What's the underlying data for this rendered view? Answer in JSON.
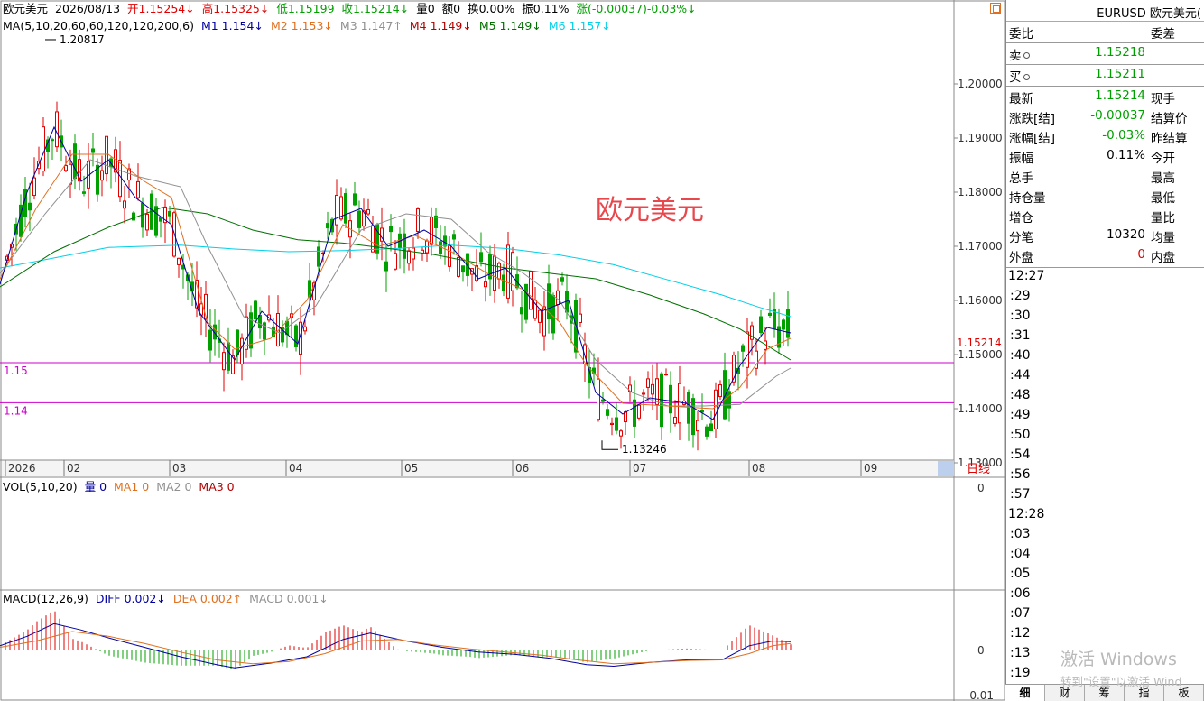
{
  "header": {
    "symbol_name": "欧元美元",
    "date": "2026/08/13",
    "open": "开1.15254↓",
    "high": "高1.15325↓",
    "low": "低1.15199",
    "close": "收1.15214↓",
    "volume": "量0",
    "amount": "额0",
    "turnover": "换0.00%",
    "amplitude": "振0.11%",
    "change": "涨(-0.00037)-0.03%↓"
  },
  "ma_legend": {
    "title": "MA(5,10,20,60,60,120,120,200,6)",
    "items": [
      {
        "label": "M1 1.154↓",
        "color": "#0000a0"
      },
      {
        "label": "M2 1.153↓",
        "color": "#e07020"
      },
      {
        "label": "M3 1.147↑",
        "color": "#909090"
      },
      {
        "label": "M4 1.149↓",
        "color": "#b00000"
      },
      {
        "label": "M5 1.149↓",
        "color": "#007000"
      },
      {
        "label": "M6 1.157↓",
        "color": "#00d0e8"
      }
    ]
  },
  "vol_legend": {
    "title": "VOL(5,10,20)",
    "items": [
      {
        "label": "量 0",
        "color": "#0000a0"
      },
      {
        "label": "MA1 0",
        "color": "#e07020"
      },
      {
        "label": "MA2 0",
        "color": "#909090"
      },
      {
        "label": "MA3 0",
        "color": "#b00000"
      }
    ]
  },
  "macd_legend": {
    "title": "MACD(12,26,9)",
    "items": [
      {
        "label": "DIFF 0.002↓",
        "color": "#0000a0"
      },
      {
        "label": "DEA 0.002↑",
        "color": "#e07020"
      },
      {
        "label": "MACD 0.001↓",
        "color": "#909090"
      }
    ]
  },
  "chart_label": "欧元美元",
  "chart_data": [
    {
      "type": "candlestick",
      "title": "欧元美元",
      "x_ticks": [
        "2026",
        "02",
        "03",
        "04",
        "05",
        "06",
        "07",
        "08",
        "09"
      ],
      "x_range_label": "日线",
      "y_ticks": [
        "1.20000",
        "1.19000",
        "1.18000",
        "1.17000",
        "1.16000",
        "1.15000",
        "1.14000",
        "1.13000"
      ],
      "ylim": [
        1.1286,
        1.2108
      ],
      "last_price_label": "1.15214",
      "annotations": [
        {
          "text": "1.20817",
          "value": 1.20817
        },
        {
          "text": "1.13246",
          "value": 1.13246
        }
      ],
      "horizontal_lines": [
        {
          "label": "1.15",
          "value": 1.1485,
          "color": "#cc00cc"
        },
        {
          "label": "1.14",
          "value": 1.1411,
          "color": "#cc00cc"
        }
      ],
      "ma_series": [
        {
          "name": "M6",
          "color": "#00d0e8",
          "values": [
            [
              0,
              1.166
            ],
            [
              40,
              1.1672
            ],
            [
              120,
              1.1698
            ],
            [
              200,
              1.1702
            ],
            [
              260,
              1.1695
            ],
            [
              320,
              1.169
            ],
            [
              380,
              1.1692
            ],
            [
              440,
              1.1696
            ],
            [
              500,
              1.1702
            ],
            [
              560,
              1.1696
            ],
            [
              620,
              1.1684
            ],
            [
              680,
              1.1666
            ],
            [
              740,
              1.1638
            ],
            [
              800,
              1.161
            ],
            [
              840,
              1.1588
            ],
            [
              876,
              1.157
            ]
          ]
        },
        {
          "name": "M5",
          "color": "#007000",
          "values": [
            [
              0,
              1.1625
            ],
            [
              60,
              1.169
            ],
            [
              120,
              1.1735
            ],
            [
              180,
              1.1772
            ],
            [
              230,
              1.176
            ],
            [
              280,
              1.173
            ],
            [
              330,
              1.1712
            ],
            [
              380,
              1.1706
            ],
            [
              430,
              1.1696
            ],
            [
              480,
              1.1685
            ],
            [
              520,
              1.1672
            ],
            [
              560,
              1.166
            ],
            [
              600,
              1.1652
            ],
            [
              660,
              1.164
            ],
            [
              720,
              1.161
            ],
            [
              780,
              1.1575
            ],
            [
              820,
              1.1547
            ],
            [
              876,
              1.149
            ]
          ]
        },
        {
          "name": "M3",
          "color": "#909090",
          "values": [
            [
              0,
              1.165
            ],
            [
              50,
              1.176
            ],
            [
              100,
              1.186
            ],
            [
              150,
              1.183
            ],
            [
              200,
              1.181
            ],
            [
              230,
              1.17
            ],
            [
              270,
              1.157
            ],
            [
              310,
              1.154
            ],
            [
              350,
              1.159
            ],
            [
              400,
              1.173
            ],
            [
              450,
              1.176
            ],
            [
              500,
              1.175
            ],
            [
              540,
              1.169
            ],
            [
              580,
              1.165
            ],
            [
              620,
              1.16
            ],
            [
              660,
              1.149
            ],
            [
              700,
              1.143
            ],
            [
              740,
              1.1405
            ],
            [
              780,
              1.1405
            ],
            [
              820,
              1.1408
            ],
            [
              860,
              1.146
            ],
            [
              876,
              1.1475
            ]
          ]
        },
        {
          "name": "M2",
          "color": "#e07020",
          "values": [
            [
              0,
              1.164
            ],
            [
              40,
              1.177
            ],
            [
              80,
              1.187
            ],
            [
              120,
              1.187
            ],
            [
              160,
              1.182
            ],
            [
              190,
              1.179
            ],
            [
              230,
              1.156
            ],
            [
              260,
              1.151
            ],
            [
              300,
              1.153
            ],
            [
              340,
              1.16
            ],
            [
              380,
              1.174
            ],
            [
              420,
              1.17
            ],
            [
              460,
              1.172
            ],
            [
              500,
              1.169
            ],
            [
              540,
              1.165
            ],
            [
              580,
              1.162
            ],
            [
              620,
              1.156
            ],
            [
              650,
              1.148
            ],
            [
              690,
              1.141
            ],
            [
              740,
              1.1405
            ],
            [
              790,
              1.14
            ],
            [
              820,
              1.144
            ],
            [
              850,
              1.151
            ],
            [
              876,
              1.153
            ]
          ]
        },
        {
          "name": "M1",
          "color": "#0000a0",
          "values": [
            [
              0,
              1.163
            ],
            [
              30,
              1.18
            ],
            [
              60,
              1.192
            ],
            [
              90,
              1.182
            ],
            [
              120,
              1.186
            ],
            [
              150,
              1.179
            ],
            [
              190,
              1.174
            ],
            [
              220,
              1.158
            ],
            [
              260,
              1.149
            ],
            [
              290,
              1.158
            ],
            [
              330,
              1.152
            ],
            [
              370,
              1.175
            ],
            [
              400,
              1.177
            ],
            [
              430,
              1.17
            ],
            [
              470,
              1.173
            ],
            [
              500,
              1.17
            ],
            [
              530,
              1.164
            ],
            [
              560,
              1.166
            ],
            [
              600,
              1.158
            ],
            [
              630,
              1.16
            ],
            [
              660,
              1.143
            ],
            [
              690,
              1.139
            ],
            [
              720,
              1.142
            ],
            [
              760,
              1.141
            ],
            [
              790,
              1.138
            ],
            [
              820,
              1.148
            ],
            [
              850,
              1.155
            ],
            [
              876,
              1.154
            ]
          ]
        }
      ]
    },
    {
      "type": "bar",
      "title": "VOL(5,10,20)",
      "y_ticks": [
        "0"
      ],
      "values": []
    },
    {
      "type": "line",
      "title": "MACD(12,26,9)",
      "y_ticks": [
        "0",
        "-0.01"
      ],
      "series": [
        {
          "name": "DIFF",
          "color": "#0000a0",
          "values": [
            [
              0,
              0.0015
            ],
            [
              30,
              0.0045
            ],
            [
              60,
              0.0085
            ],
            [
              90,
              0.0065
            ],
            [
              120,
              0.004
            ],
            [
              160,
              0.001
            ],
            [
              200,
              -0.002
            ],
            [
              240,
              -0.0045
            ],
            [
              260,
              -0.0055
            ],
            [
              300,
              -0.004
            ],
            [
              340,
              -0.002
            ],
            [
              380,
              0.0035
            ],
            [
              410,
              0.0055
            ],
            [
              450,
              0.003
            ],
            [
              490,
              0.001
            ],
            [
              530,
              -0.0005
            ],
            [
              570,
              -0.0012
            ],
            [
              610,
              -0.0025
            ],
            [
              650,
              -0.0045
            ],
            [
              680,
              -0.005
            ],
            [
              720,
              -0.0038
            ],
            [
              760,
              -0.003
            ],
            [
              800,
              -0.003
            ],
            [
              830,
              0.0015
            ],
            [
              856,
              0.003
            ],
            [
              876,
              0.0028
            ]
          ]
        },
        {
          "name": "DEA",
          "color": "#e07020",
          "values": [
            [
              0,
              0.001
            ],
            [
              40,
              0.003
            ],
            [
              80,
              0.006
            ],
            [
              120,
              0.0045
            ],
            [
              160,
              0.0022
            ],
            [
              200,
              -0.0005
            ],
            [
              240,
              -0.003
            ],
            [
              280,
              -0.0042
            ],
            [
              320,
              -0.0035
            ],
            [
              360,
              -0.001
            ],
            [
              400,
              0.003
            ],
            [
              440,
              0.0035
            ],
            [
              480,
              0.0018
            ],
            [
              520,
              0.0005
            ],
            [
              560,
              -0.0005
            ],
            [
              600,
              -0.0015
            ],
            [
              640,
              -0.003
            ],
            [
              680,
              -0.0042
            ],
            [
              720,
              -0.0038
            ],
            [
              760,
              -0.0032
            ],
            [
              800,
              -0.003
            ],
            [
              830,
              -0.001
            ],
            [
              856,
              0.0015
            ],
            [
              876,
              0.0022
            ]
          ]
        }
      ]
    }
  ],
  "quote_panel": {
    "title": "EURUSD 欧元美元(",
    "header_row": {
      "left": "委比",
      "right": "委差"
    },
    "sell": {
      "label": "卖",
      "value": "1.15218"
    },
    "buy": {
      "label": "买",
      "value": "1.15211"
    },
    "rows": [
      {
        "left": "最新",
        "value": "1.15214",
        "value_color": "#00a000",
        "right": "现手"
      },
      {
        "left": "涨跌[结]",
        "value": "-0.00037",
        "value_color": "#00a000",
        "right": "结算价"
      },
      {
        "left": "涨幅[结]",
        "value": "-0.03%",
        "value_color": "#00a000",
        "right": "昨结算"
      },
      {
        "left": "振幅",
        "value": "0.11%",
        "value_color": "#000000",
        "right": "今开"
      },
      {
        "left": "总手",
        "value": "",
        "value_color": "#000000",
        "right": "最高"
      },
      {
        "left": "持仓量",
        "value": "",
        "value_color": "#000000",
        "right": "最低"
      },
      {
        "left": "增仓",
        "value": "",
        "value_color": "#000000",
        "right": "量比"
      },
      {
        "left": "分笔",
        "value": "10320",
        "value_color": "#000000",
        "right": "均量"
      },
      {
        "left": "外盘",
        "value": "0",
        "value_color": "#e00000",
        "right": "内盘"
      }
    ],
    "times": [
      "12:27",
      ":29",
      ":30",
      ":31",
      ":40",
      ":44",
      ":48",
      ":49",
      ":50",
      ":54",
      ":56",
      ":57",
      "12:28",
      ":03",
      ":04",
      ":05",
      ":06",
      ":07",
      ":12",
      ":13",
      ":19"
    ]
  },
  "tabs": [
    "细",
    "财",
    "筹",
    "指",
    "板"
  ],
  "watermark": {
    "line1": "激活 Windows",
    "line2": "转到\"设置\"以激活 Wind"
  }
}
